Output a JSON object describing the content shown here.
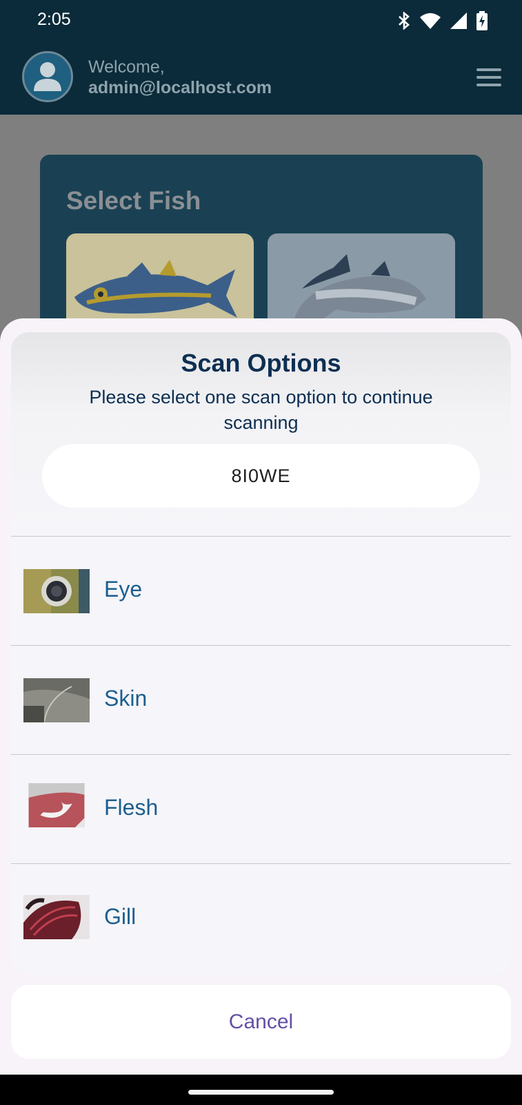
{
  "status_bar": {
    "time": "2:05",
    "icons": [
      "bluetooth-icon",
      "wifi-icon",
      "signal-icon",
      "battery-charging-icon"
    ]
  },
  "header": {
    "welcome": "Welcome,",
    "email": "admin@localhost.com",
    "avatar_icon": "person-icon",
    "menu_icon": "hamburger-menu-icon"
  },
  "background_card": {
    "title": "Select Fish"
  },
  "scan_sheet": {
    "title": "Scan Options",
    "subtitle": "Please select one scan option to continue scanning",
    "code": "8I0WE",
    "options": [
      {
        "label": "Eye"
      },
      {
        "label": "Skin"
      },
      {
        "label": "Flesh"
      },
      {
        "label": "Gill"
      }
    ],
    "cancel_label": "Cancel"
  },
  "colors": {
    "header_bg": "#0b2b3a",
    "title_text": "#0d2f52",
    "option_text": "#1c5f8f",
    "cancel_text": "#6650a4"
  }
}
